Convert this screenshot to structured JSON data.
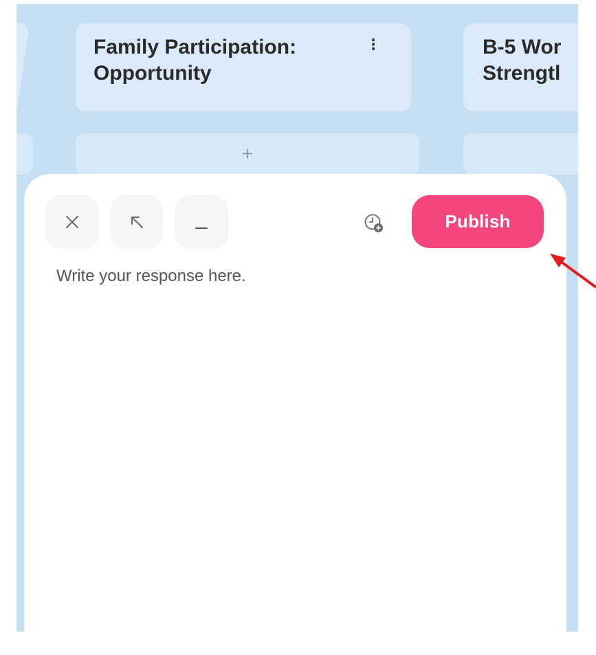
{
  "board": {
    "columns": [
      {
        "title_line1": "Family Participation:",
        "title_line2": "Opportunity",
        "menu_icon": "more-vertical-icon"
      },
      {
        "title_line1": "B-5 Wor",
        "title_line2": "Strengtl"
      }
    ],
    "add_label": "+"
  },
  "composer": {
    "close_icon": "close-icon",
    "expand_icon": "arrow-up-left-icon",
    "minimize_icon": "minimize-icon",
    "schedule_icon": "clock-plus-icon",
    "publish_label": "Publish",
    "response_placeholder": "Write your response here."
  },
  "colors": {
    "board_background": "#c5def2",
    "column_header": "#dbeaf8",
    "publish_button": "#f5457d",
    "annotation_arrow": "#e01e1e"
  }
}
